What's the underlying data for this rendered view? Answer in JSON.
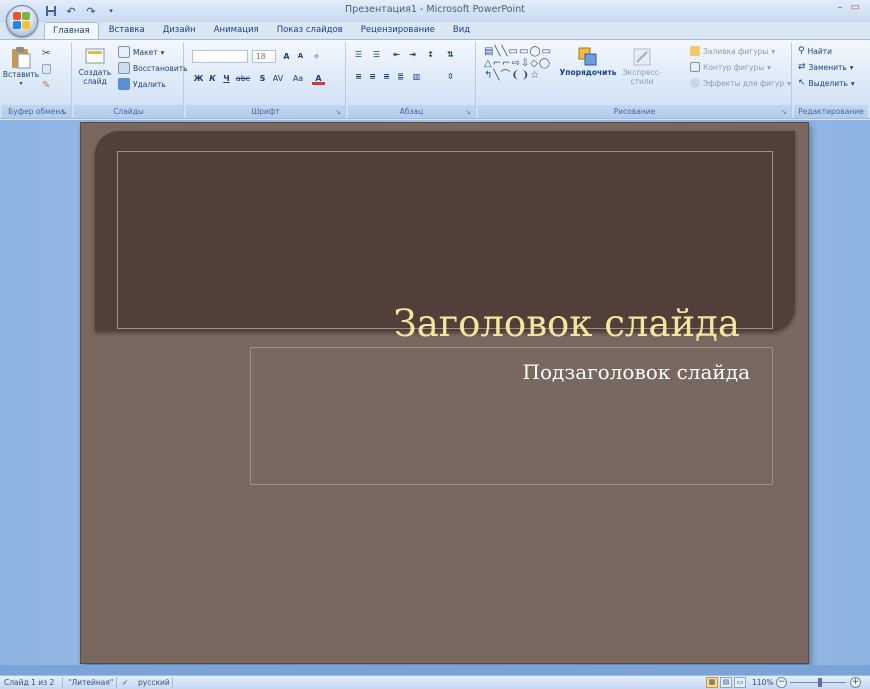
{
  "window": {
    "title": "Презентация1 - Microsoft PowerPoint",
    "minimize": "–",
    "maximize": "▭"
  },
  "qat": {
    "save_icon": "save-icon",
    "undo_icon": "undo-icon",
    "redo_icon": "redo-icon",
    "dropdown_icon": "chevron-down-icon"
  },
  "tabs": [
    {
      "label": "Главная",
      "active": true
    },
    {
      "label": "Вставка"
    },
    {
      "label": "Дизайн"
    },
    {
      "label": "Анимация"
    },
    {
      "label": "Показ слайдов"
    },
    {
      "label": "Рецензирование"
    },
    {
      "label": "Вид"
    }
  ],
  "ribbon": {
    "clipboard": {
      "paste_label": "Вставить",
      "group_label": "Буфер обмена"
    },
    "slides": {
      "new_slide_label": "Создать слайд",
      "layout_label": "Макет",
      "reset_label": "Восстановить",
      "delete_label": "Удалить",
      "group_label": "Слайды"
    },
    "font": {
      "font_size": "18",
      "grow_label": "A",
      "shrink_label": "A",
      "bold": "Ж",
      "italic": "К",
      "underline": "Ч",
      "strike": "abc",
      "shadow": "S",
      "spacing": "AV",
      "case": "Aa",
      "color": "A",
      "group_label": "Шрифт"
    },
    "paragraph": {
      "group_label": "Абзац"
    },
    "drawing": {
      "arrange_label": "Упорядочить",
      "quick_styles_label": "Экспресс-стили",
      "shape_fill_label": "Заливка фигуры",
      "shape_outline_label": "Контур фигуры",
      "shape_effects_label": "Эффекты для фигур",
      "group_label": "Рисование"
    },
    "editing": {
      "find_label": "Найти",
      "replace_label": "Заменить",
      "select_label": "Выделить",
      "group_label": "Редактирование"
    }
  },
  "slide": {
    "title": "Заголовок слайда",
    "subtitle": "Подзаголовок слайда"
  },
  "status": {
    "slide_info": "Слайд 1 из 2",
    "theme": "\"Литейная\"",
    "language": "русский",
    "zoom": "110%",
    "zoom_minus": "−",
    "zoom_plus": "+"
  },
  "colors": {
    "slide_bg": "#78685f",
    "title_band": "#504039",
    "title_text": "#f3e7a0",
    "subtitle_text": "#ffffff",
    "ribbon_accent": "#15428b"
  }
}
